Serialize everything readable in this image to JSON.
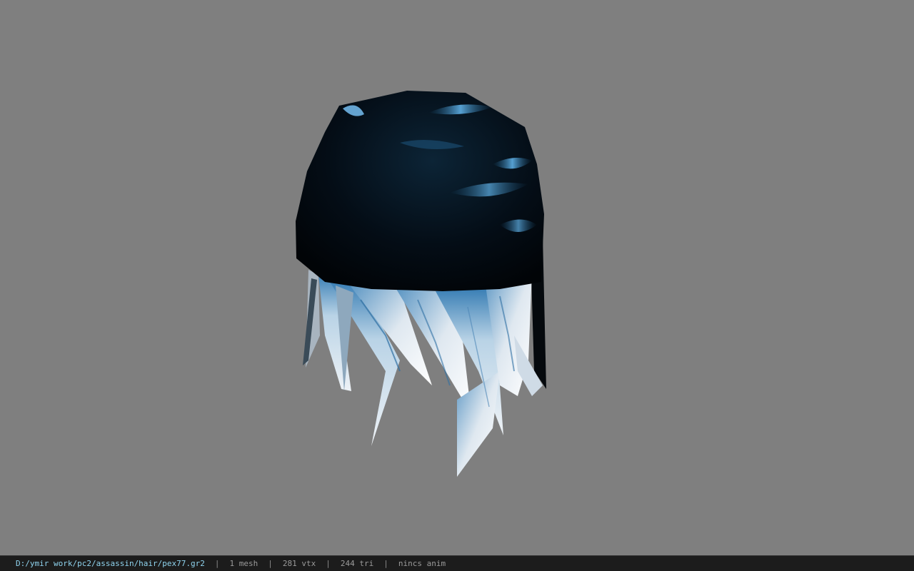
{
  "viewer": {
    "background_color": "#7f7f7f",
    "model_icon": "hair-mesh-icon"
  },
  "status": {
    "file_path": "D:/ymir work/pc2/assassin/hair/pex77.gr2",
    "separator": "|",
    "mesh_count": "1 mesh",
    "vertex_count": "281 vtx",
    "triangle_count": "244 tri",
    "animation": "nincs anim"
  },
  "colors": {
    "path_text": "#8fd3ee",
    "status_text": "#9a9a9a",
    "status_bg": "#1c1c1c"
  }
}
